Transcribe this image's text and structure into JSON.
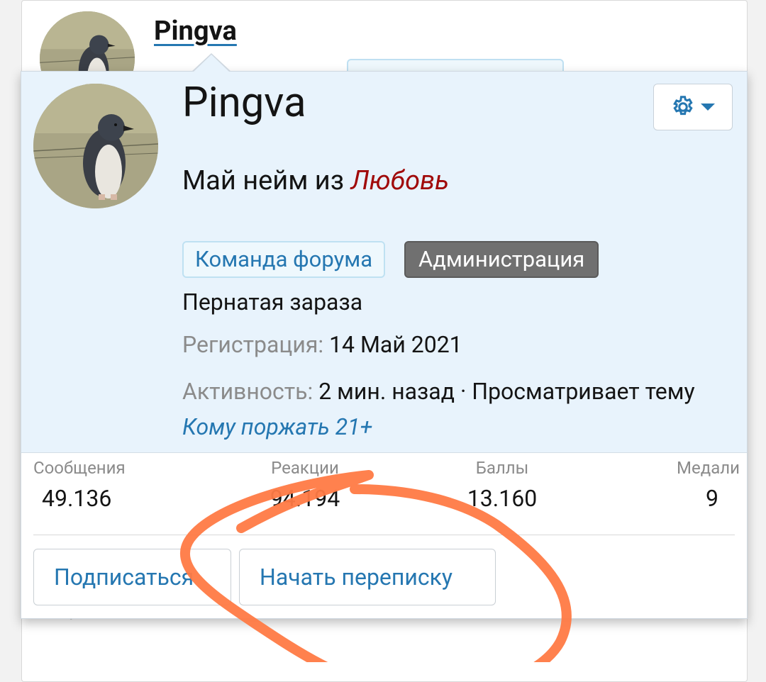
{
  "background_post": {
    "username": "Pingva"
  },
  "member_tooltip": {
    "username": "Pingva",
    "title_prefix": "Май нейм из ",
    "title_highlight": "Любовь",
    "banners": [
      "Команда форума",
      "Администрация"
    ],
    "user_title": "Пернатая зараза",
    "registration_label": "Регистрация:",
    "registration_value": "14 Май 2021",
    "activity_label": "Активность:",
    "activity_value": "2 мин. назад · Просматривает тему",
    "activity_thread": "Кому поржать 21+",
    "stats": [
      {
        "label": "Сообщения",
        "value": "49.136"
      },
      {
        "label": "Реакции",
        "value": "94.194"
      },
      {
        "label": "Баллы",
        "value": "13.160"
      },
      {
        "label": "Медали",
        "value": "9"
      }
    ],
    "buttons": {
      "follow": "Подписаться",
      "start_conversation": "Начать переписку"
    },
    "gear_icon": "gear-icon",
    "dropdown_icon": "caret-down-icon"
  },
  "colors": {
    "link": "#2577b1",
    "popup_bg": "#e8f3fc",
    "title_highlight": "#a00a0a",
    "annotation": "#ff7a45"
  }
}
